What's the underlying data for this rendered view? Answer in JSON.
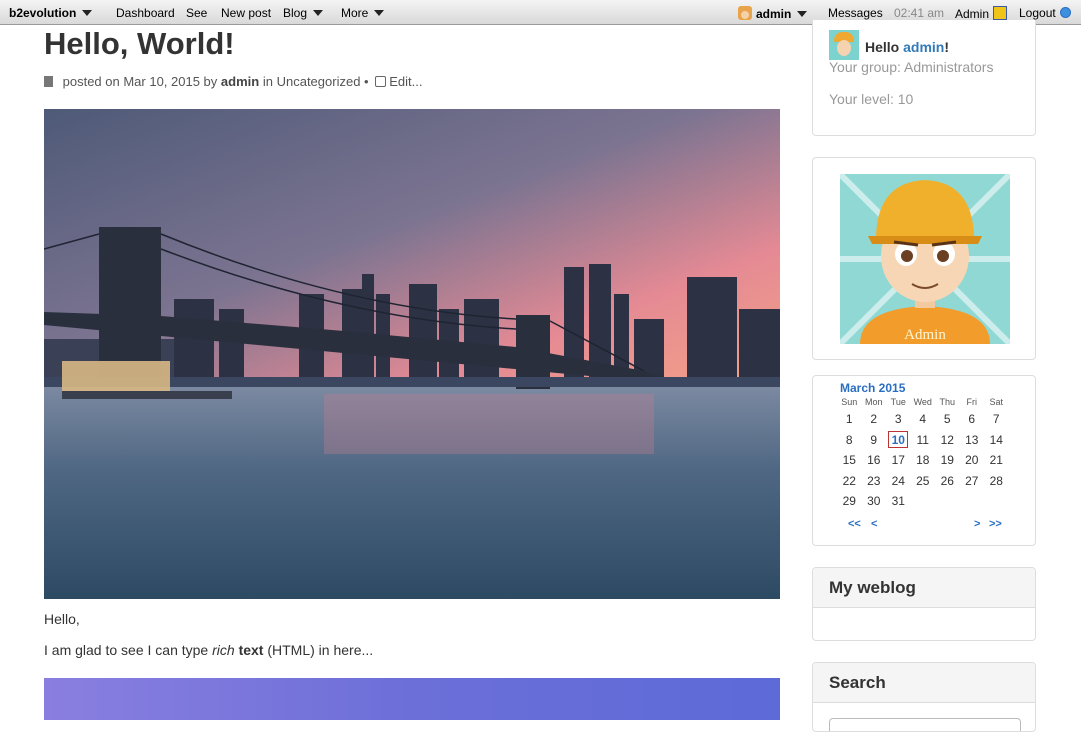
{
  "toolbar": {
    "brand": "b2evolution",
    "dashboard": "Dashboard",
    "see": "See",
    "new_post": "New post",
    "blog": "Blog",
    "more": "More",
    "user": "admin",
    "messages": "Messages",
    "time": "02:41 am",
    "admin": "Admin",
    "logout": "Logout"
  },
  "post": {
    "title": "Hello, World!",
    "meta_prefix": "posted on Mar 10, 2015 by",
    "author": "admin",
    "meta_in": "in",
    "category": "Uncategorized",
    "separator": "•",
    "edit": "Edit...",
    "para1": "Hello,",
    "para2_a": "I am glad to see I can type",
    "para2_rich": "rich",
    "para2_text": "text",
    "para2_b": "(HTML) in here..."
  },
  "sidebar": {
    "user": {
      "hello": "Hello",
      "name": "admin",
      "exclaim": "!",
      "group": "Your group: Administrators",
      "level": "Your level: 10"
    },
    "avatar_label": "Admin",
    "calendar": {
      "month": "March 2015",
      "days": [
        "Sun",
        "Mon",
        "Tue",
        "Wed",
        "Thu",
        "Fri",
        "Sat"
      ],
      "weeks": [
        [
          "1",
          "2",
          "3",
          "4",
          "5",
          "6",
          "7"
        ],
        [
          "8",
          "9",
          "10",
          "11",
          "12",
          "13",
          "14"
        ],
        [
          "15",
          "16",
          "17",
          "18",
          "19",
          "20",
          "21"
        ],
        [
          "22",
          "23",
          "24",
          "25",
          "26",
          "27",
          "28"
        ],
        [
          "29",
          "30",
          "31",
          "",
          "",
          "",
          ""
        ]
      ],
      "today": "10",
      "prev_year": "<<",
      "prev_month": "<",
      "next_month": ">",
      "next_year": ">>"
    },
    "weblog_title": "My weblog",
    "search_title": "Search"
  }
}
